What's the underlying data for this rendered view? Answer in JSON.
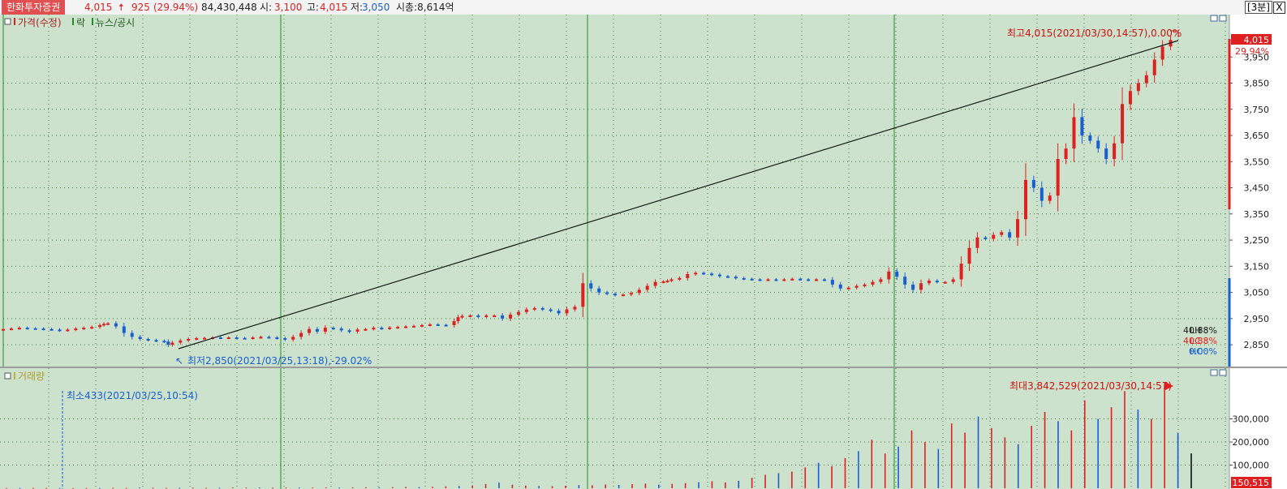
{
  "header": {
    "stock_name": "한화투자증권",
    "price": "4,015",
    "change": "925",
    "change_pct": "(29.94%)",
    "volume": "84,430,448",
    "open_label": "시:",
    "open": "3,100",
    "high_label": "고:",
    "high": "4,015",
    "low_label": "저:",
    "low": "3,050",
    "mcap": "시총:8,614억",
    "interval": "[3분]",
    "close": "X"
  },
  "colors": {
    "background": "#cce2cc",
    "up": "#e02020",
    "down": "#1a5fd0",
    "grid": "#3f7a3f",
    "session": "#1f8f1f"
  },
  "price_panel": {
    "legend_items": [
      "가격(수정)",
      "락",
      "뉴스/공시"
    ],
    "high_note": "최고4,015(2021/03/30,14:57),0.00%",
    "low_note": "최저2,850(2021/03/25,13:18),-29.02%",
    "current_price": "4,015",
    "current_pct": "29.94%",
    "stats": [
      {
        "label": "LH",
        "value": "40.88%"
      },
      {
        "label": "LC",
        "value": "40.88%"
      },
      {
        "label": "HC",
        "value": "0.00%"
      }
    ]
  },
  "volume_panel": {
    "legend": "거래량",
    "max_note": "최대3,842,529(2021/03/30,14:57)",
    "min_note": "최소433(2021/03/25,10:54)",
    "current_volume": "150,515"
  },
  "chart_data": [
    {
      "type": "line",
      "series": [
        {
          "x": [
            0,
            10,
            20,
            30,
            40,
            50,
            60,
            70,
            80,
            90,
            100,
            110,
            120,
            125,
            130,
            140,
            150,
            160,
            170,
            180,
            190,
            200,
            205,
            210,
            220,
            230,
            240,
            250,
            260,
            270,
            280,
            290,
            300,
            310,
            320,
            330,
            340,
            350,
            360,
            370,
            380,
            390,
            400,
            410,
            420,
            430,
            440,
            450,
            460,
            470,
            480,
            490,
            500,
            510,
            520,
            530,
            540,
            550,
            560,
            565,
            570,
            580,
            590,
            600,
            610,
            620,
            630,
            640,
            650,
            660,
            670,
            680,
            690,
            700,
            710,
            720,
            730,
            740,
            750,
            760,
            770,
            780,
            790,
            800,
            810,
            820,
            825,
            830,
            840,
            850,
            860,
            870,
            880,
            890,
            900,
            910,
            920,
            930,
            940,
            950,
            960,
            970,
            980,
            990,
            1000,
            1010,
            1020,
            1030,
            1040,
            1050,
            1060,
            1070,
            1080,
            1090,
            1100,
            1110,
            1120,
            1130,
            1140,
            1150,
            1160,
            1170,
            1180,
            1190,
            1200,
            1210,
            1220,
            1230,
            1240,
            1250,
            1260,
            1270,
            1280,
            1290,
            1300,
            1310,
            1320,
            1330,
            1340,
            1350,
            1360,
            1370,
            1380,
            1390,
            1400,
            1410,
            1420,
            1430,
            1440,
            1450
          ],
          "y": [
            2910,
            2912,
            2915,
            2913,
            2912,
            2910,
            2908,
            2905,
            2908,
            2912,
            2915,
            2918,
            2925,
            2930,
            2932,
            2920,
            2895,
            2880,
            2872,
            2868,
            2865,
            2862,
            2850,
            2858,
            2866,
            2872,
            2875,
            2876,
            2878,
            2877,
            2878,
            2876,
            2875,
            2878,
            2880,
            2878,
            2875,
            2870,
            2880,
            2895,
            2910,
            2900,
            2915,
            2912,
            2905,
            2900,
            2908,
            2910,
            2915,
            2912,
            2916,
            2918,
            2920,
            2922,
            2925,
            2928,
            2926,
            2925,
            2940,
            2955,
            2960,
            2962,
            2958,
            2962,
            2962,
            2950,
            2965,
            2975,
            2985,
            2990,
            2985,
            2980,
            2970,
            2985,
            2995,
            3085,
            3065,
            3050,
            3045,
            3040,
            3042,
            3048,
            3060,
            3075,
            3090,
            3092,
            3095,
            3100,
            3105,
            3120,
            3125,
            3122,
            3118,
            3112,
            3110,
            3105,
            3102,
            3100,
            3098,
            3100,
            3098,
            3100,
            3102,
            3100,
            3098,
            3100,
            3098,
            3080,
            3065,
            3068,
            3075,
            3080,
            3090,
            3100,
            3130,
            3110,
            3080,
            3060,
            3085,
            3095,
            3090,
            3090,
            3100,
            3160,
            3220,
            3260,
            3255,
            3270,
            3280,
            3260,
            3330,
            3480,
            3450,
            3400,
            3420,
            3560,
            3600,
            3720,
            3650,
            3630,
            3600,
            3560,
            3620,
            3770,
            3820,
            3850,
            3880,
            3940,
            3990,
            4015
          ]
        }
      ],
      "xlabel": "",
      "ylabel": "",
      "y_ticks": [
        "2,850",
        "2,950",
        "3,050",
        "3,150",
        "3,250",
        "3,350",
        "3,450",
        "3,550",
        "3,650",
        "3,750",
        "3,850",
        "3,950",
        "4,015"
      ],
      "ylim": [
        2810,
        4050
      ],
      "grid": true
    },
    {
      "type": "bar",
      "values": [
        1200,
        900,
        1500,
        800,
        1100,
        433,
        1400,
        1000,
        2200,
        1800,
        3000,
        2500,
        1900,
        2100,
        2600,
        2000,
        2400,
        3500,
        2800,
        3200,
        2700,
        3100,
        2600,
        2900,
        3400,
        3000,
        3600,
        4100,
        3800,
        4500,
        5200,
        4800,
        6000,
        7500,
        9000,
        12000,
        18000,
        24000,
        15000,
        11000,
        9500,
        8800,
        10500,
        13000,
        12500,
        16000,
        14000,
        17500,
        20000,
        15500,
        18500,
        22000,
        26000,
        30000,
        25000,
        32000,
        45000,
        58000,
        65000,
        72000,
        90000,
        110000,
        95000,
        130000,
        160000,
        210000,
        150000,
        180000,
        250000,
        200000,
        170000,
        280000,
        240000,
        310000,
        260000,
        220000,
        190000,
        270000,
        330000,
        290000,
        250000,
        380000,
        300000,
        350000,
        420000,
        340000,
        300000,
        3842529,
        240000,
        150515
      ],
      "ylim": [
        0,
        400000
      ],
      "y_ticks": [
        "100,000",
        "200,000",
        "300,000"
      ],
      "grid": true
    }
  ]
}
